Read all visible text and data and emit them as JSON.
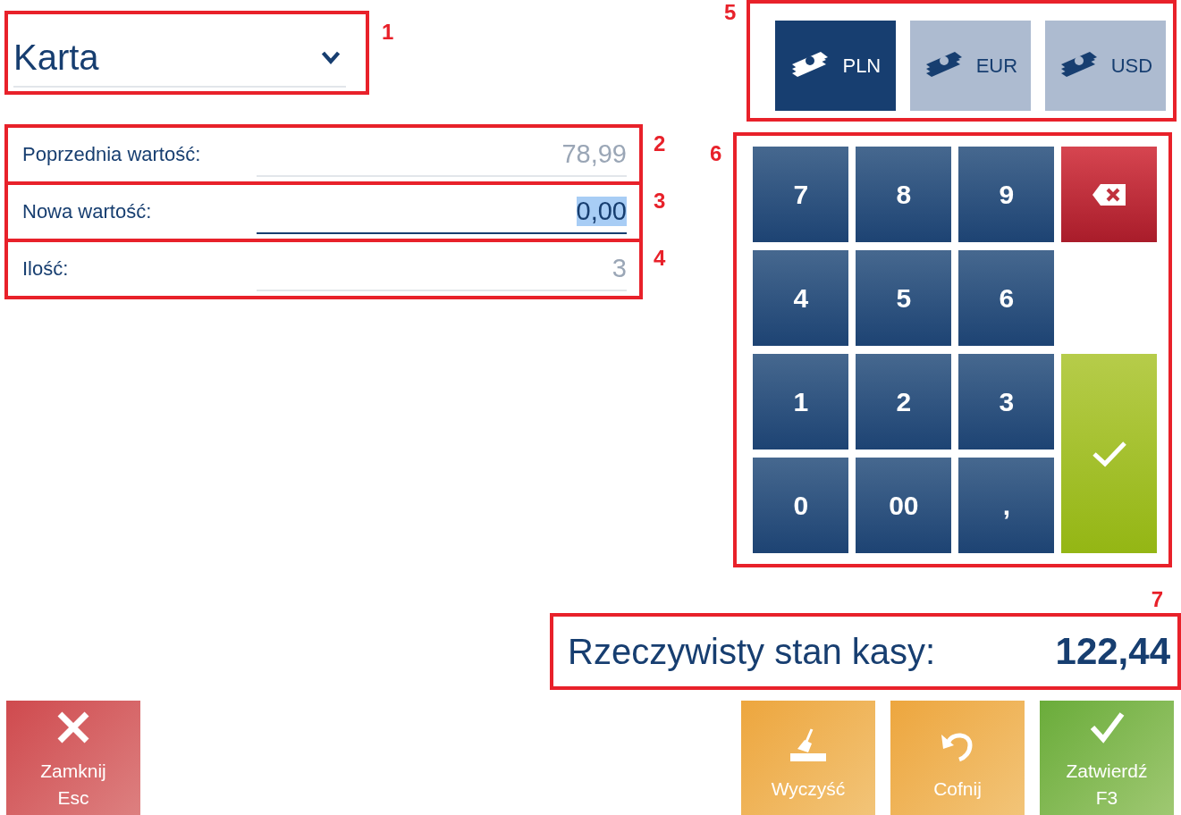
{
  "payment_type": {
    "value": "Karta",
    "callout": "1"
  },
  "fields": [
    {
      "label": "Poprzednia wartość:",
      "value": "78,99",
      "focused": false,
      "callout": "2"
    },
    {
      "label": "Nowa wartość:",
      "value": "0,00",
      "focused": true,
      "callout": "3"
    },
    {
      "label": "Ilość:",
      "value": "3",
      "focused": false,
      "callout": "4"
    }
  ],
  "currencies": {
    "callout": "5",
    "items": [
      {
        "label": "PLN",
        "selected": true
      },
      {
        "label": "EUR",
        "selected": false
      },
      {
        "label": "USD",
        "selected": false
      }
    ]
  },
  "keypad": {
    "callout": "6",
    "keys": [
      "7",
      "8",
      "9",
      "4",
      "5",
      "6",
      "1",
      "2",
      "3",
      "0",
      "00",
      ","
    ]
  },
  "cash_total": {
    "callout": "7",
    "label": "Rzeczywisty stan kasy:",
    "value": "122,44"
  },
  "buttons": [
    {
      "kind": "close",
      "label": "Zamknij",
      "shortcut": "Esc"
    },
    {
      "kind": "clear",
      "label": "Wyczyść"
    },
    {
      "kind": "undo",
      "label": "Cofnij"
    },
    {
      "kind": "confirm",
      "label": "Zatwierdź",
      "shortcut": "F3"
    }
  ]
}
